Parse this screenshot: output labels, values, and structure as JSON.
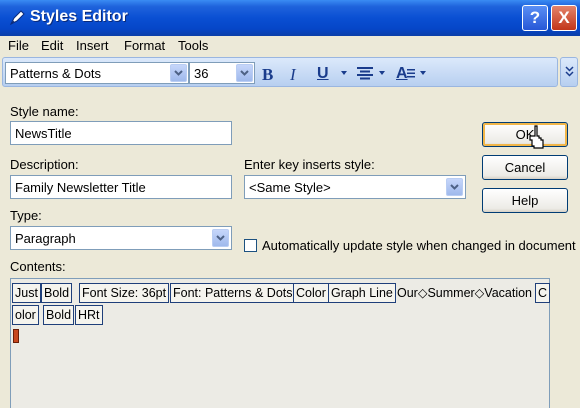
{
  "window": {
    "title": "Styles Editor",
    "help_glyph": "?",
    "close_glyph": "X"
  },
  "menu": [
    "File",
    "Edit",
    "Insert",
    "Format",
    "Tools"
  ],
  "toolbar": {
    "font": "Patterns & Dots",
    "size": "36",
    "bold": "B",
    "italic": "I",
    "underline": "U",
    "font_color_glyph": "A"
  },
  "form": {
    "style_name_label": "Style name:",
    "style_name_value": "NewsTitle",
    "description_label": "Description:",
    "description_value": "Family Newsletter Title",
    "enter_key_label": "Enter key inserts style:",
    "enter_key_value": "<Same Style>",
    "type_label": "Type:",
    "type_value": "Paragraph",
    "auto_update_label": "Automatically update style when changed in document",
    "contents_label": "Contents:"
  },
  "buttons": {
    "ok": "OK",
    "cancel": "Cancel",
    "help": "Help"
  },
  "contents_codes": {
    "just": "Just",
    "bold1": "Bold",
    "font_size": "Font Size: 36pt",
    "font": "Font: Patterns & Dots",
    "color1": "Color",
    "graph_line": "Graph Line",
    "text": "Our◇Summer◇Vacation",
    "color_part_a": "C",
    "color_part_b": "olor",
    "bold2": "Bold",
    "hrt": "HRt"
  }
}
